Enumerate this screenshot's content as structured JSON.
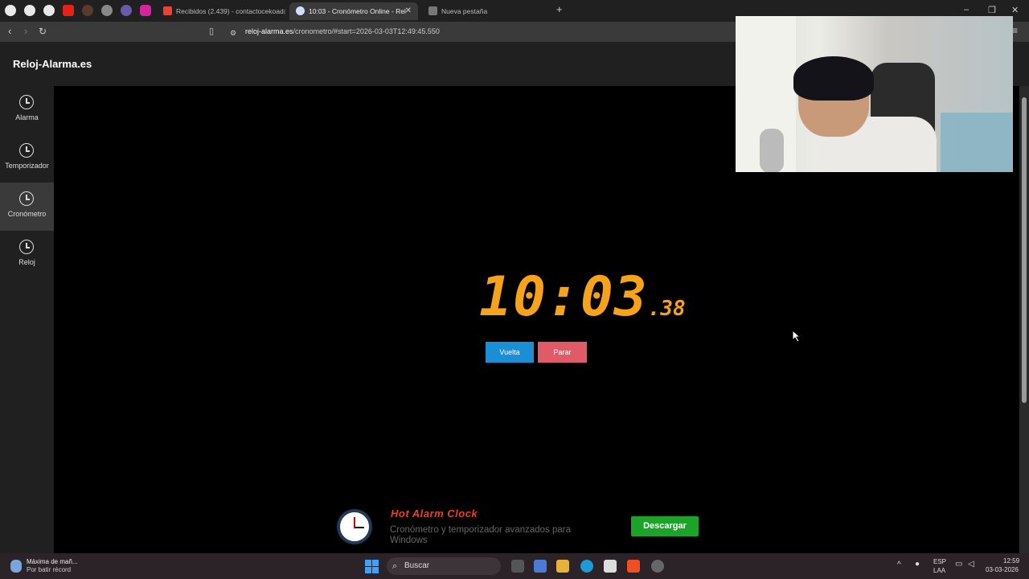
{
  "browser": {
    "tabs": [
      {
        "label": "Recibidos (2.439) - contactocekoad@",
        "active": false
      },
      {
        "label": "10:03 - Cronómetro Online - Rel",
        "active": true
      },
      {
        "label": "Nueva pestaña",
        "active": false
      }
    ],
    "new_tab_label": "+",
    "url_domain": "reloj-alarma.es",
    "url_path": "/cronometro/#start=2026-03-03T12:49:45.550"
  },
  "site": {
    "title": "Reloj-Alarma.es",
    "nav": [
      {
        "label": "Alarma",
        "icon": "alarm-clock-icon"
      },
      {
        "label": "Temporizador",
        "icon": "timer-icon"
      },
      {
        "label": "Cronómetro",
        "icon": "stopwatch-icon",
        "active": true
      },
      {
        "label": "Reloj",
        "icon": "clock-icon"
      }
    ]
  },
  "stopwatch": {
    "time": "10:03",
    "hundredths": ".38",
    "lap_label": "Vuelta",
    "stop_label": "Parar",
    "digit_color": "#f6a21b"
  },
  "ad": {
    "title": "Hot Alarm Clock",
    "description": "Cronómetro y temporizador avanzados para Windows",
    "button_label": "Descargar"
  },
  "taskbar": {
    "news_title": "Máxima de mañ...",
    "news_subtitle": "Por batir récord",
    "search_placeholder": "Buscar",
    "lang_top": "ESP",
    "lang_bottom": "LAA",
    "time": "12:59",
    "date": "03-03-2026"
  }
}
